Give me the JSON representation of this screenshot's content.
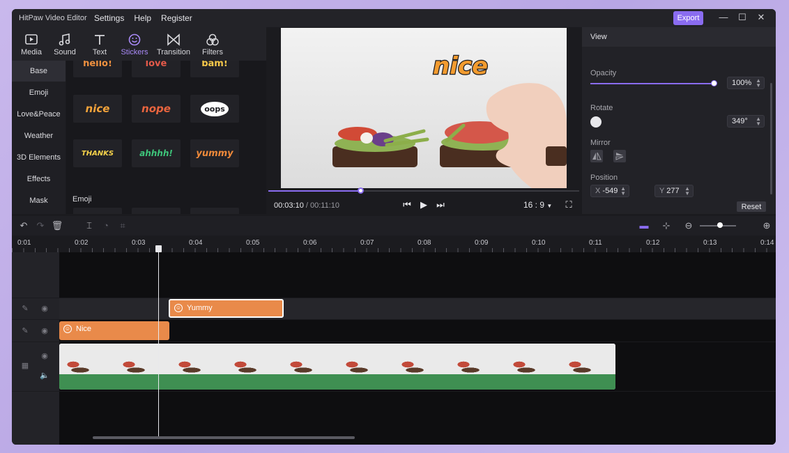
{
  "app": {
    "title": "HitPaw Video Editor",
    "menu": [
      "Settings",
      "Help",
      "Register"
    ],
    "export_label": "Export",
    "accent": "#8a6cf0"
  },
  "tools": [
    {
      "label": "Media",
      "icon": "media-icon"
    },
    {
      "label": "Sound",
      "icon": "music-note-icon"
    },
    {
      "label": "Text",
      "icon": "text-t-icon"
    },
    {
      "label": "Stickers",
      "icon": "smiley-icon",
      "active": true
    },
    {
      "label": "Transition",
      "icon": "bowtie-icon"
    },
    {
      "label": "Filters",
      "icon": "filters-icon"
    }
  ],
  "categories": [
    "Base",
    "Emoji",
    "Love&Peace",
    "Weather",
    "3D Elements",
    "Effects",
    "Mask"
  ],
  "stickers": {
    "row0": [
      "hello!",
      "love",
      "bam!"
    ],
    "row1": [
      "nice",
      "nope",
      "oops"
    ],
    "row2": [
      "THANKS",
      "ahhhh!",
      "yummy"
    ],
    "section_label": "Emoji"
  },
  "preview": {
    "sticker_text": "nice",
    "current_time": "00:03:10",
    "separator": " / ",
    "total_time": "00:11:10",
    "progress": 0.295,
    "aspect_ratio": "16 : 9"
  },
  "view": {
    "header": "View",
    "opacity_label": "Opacity",
    "opacity_value": "100%",
    "opacity_level": 1.0,
    "rotate_label": "Rotate",
    "rotate_value": "349°",
    "mirror_label": "Mirror",
    "position_label": "Position",
    "x_label": "X",
    "x_value": "-549",
    "y_label": "Y",
    "y_value": "277",
    "reset_label": "Reset"
  },
  "ruler": [
    "0:01",
    "0:02",
    "0:03",
    "0:04",
    "0:05",
    "0:06",
    "0:07",
    "0:08",
    "0:09",
    "0:10",
    "0:11",
    "0:12",
    "0:13",
    "0:14"
  ],
  "clips": {
    "yummy_label": "Yummy",
    "nice_label": "Nice"
  }
}
